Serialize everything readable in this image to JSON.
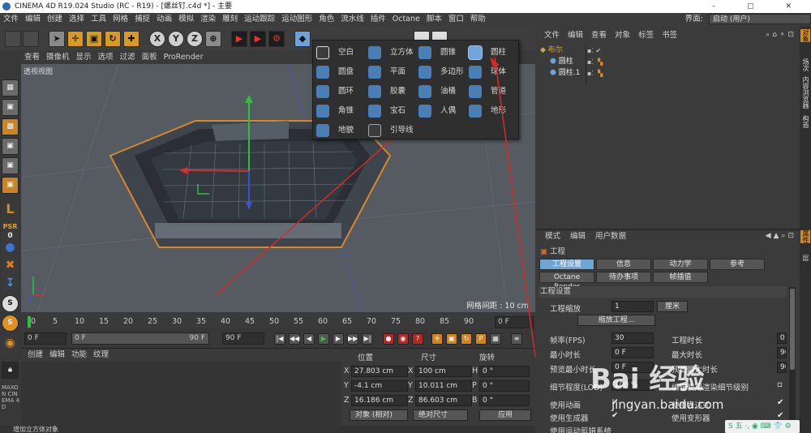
{
  "window": {
    "title": "CINEMA 4D R19.024 Studio (RC - R19) - [螺丝钉.c4d *] - 主要",
    "controls": "– ▢ ✕"
  },
  "menubar": {
    "items": [
      "文件",
      "编辑",
      "创建",
      "选择",
      "工具",
      "网格",
      "捕捉",
      "动画",
      "模拟",
      "渲染",
      "雕刻",
      "运动跟踪",
      "运动图形",
      "角色",
      "流水线",
      "插件",
      "Octane",
      "脚本",
      "窗口",
      "帮助"
    ],
    "layout_label": "界面:",
    "layout_value": "启动 (用户)"
  },
  "toolbar": {
    "x_axis": "X",
    "y_axis": "Y",
    "z_axis": "Z"
  },
  "left_tools": {
    "psr_label": "PSR",
    "psr_value": "0",
    "s_label": "S",
    "maxon_label": "MAXON CINEMA 4D"
  },
  "viewport": {
    "menu": [
      "查看",
      "摄像机",
      "显示",
      "选项",
      "过滤",
      "面板",
      "ProRender"
    ],
    "view_name": "透视视图",
    "grid_spacing": "网格间距 : 10 cm"
  },
  "popup": {
    "items": [
      {
        "icon": "null-icon",
        "label": "空白"
      },
      {
        "icon": "cube-icon",
        "label": "立方体"
      },
      {
        "icon": "cone-icon",
        "label": "圆锥"
      },
      {
        "icon": "cylinder-icon",
        "label": "圆柱"
      },
      {
        "icon": "disc-icon",
        "label": "圆盘"
      },
      {
        "icon": "plane-icon",
        "label": "平面"
      },
      {
        "icon": "polygon-icon",
        "label": "多边形"
      },
      {
        "icon": "sphere-icon",
        "label": "球体"
      },
      {
        "icon": "torus-icon",
        "label": "圆环"
      },
      {
        "icon": "capsule-icon",
        "label": "胶囊"
      },
      {
        "icon": "oiltank-icon",
        "label": "油桶"
      },
      {
        "icon": "tube-icon",
        "label": "管道"
      },
      {
        "icon": "pyramid-icon",
        "label": "角锥"
      },
      {
        "icon": "platonic-icon",
        "label": "宝石"
      },
      {
        "icon": "figure-icon",
        "label": "人偶"
      },
      {
        "icon": "landscape-icon",
        "label": "地形"
      },
      {
        "icon": "relief-icon",
        "label": "地貌"
      },
      {
        "icon": "guide-icon",
        "label": "引导线"
      }
    ]
  },
  "timeline": {
    "ticks": [
      "0",
      "5",
      "10",
      "15",
      "20",
      "25",
      "30",
      "35",
      "40",
      "45",
      "50",
      "55",
      "60",
      "65",
      "70",
      "75",
      "80",
      "85",
      "90"
    ],
    "frame_box": "0 F"
  },
  "playback": {
    "start": "0 F",
    "slider_start": "0 F",
    "slider_end": "90 F",
    "end": "90 F"
  },
  "material": {
    "menu": [
      "创建",
      "编辑",
      "功能",
      "纹理"
    ]
  },
  "coordinates": {
    "headers": {
      "position": "位置",
      "size": "尺寸",
      "rotation": "旋转"
    },
    "rows": [
      {
        "axis": "X",
        "pos": "27.803 cm",
        "size_axis": "X",
        "size": "100 cm",
        "rot_axis": "H",
        "rot": "0 °"
      },
      {
        "axis": "Y",
        "pos": "-4.1 cm",
        "size_axis": "Y",
        "size": "10.011 cm",
        "rot_axis": "P",
        "rot": "0 °"
      },
      {
        "axis": "Z",
        "pos": "16.186 cm",
        "size_axis": "Z",
        "size": "86.603 cm",
        "rot_axis": "B",
        "rot": "0 °"
      }
    ],
    "mode": "对象 (相对)",
    "size_mode": "绝对尺寸",
    "apply": "应用"
  },
  "status": {
    "text": "增加立方体对象"
  },
  "object_manager": {
    "menu": [
      "文件",
      "编辑",
      "查看",
      "对象",
      "标签",
      "书签"
    ],
    "objects": [
      {
        "name": "布尔",
        "indent": 0,
        "color": "#e0a23a"
      },
      {
        "name": "圆柱",
        "indent": 1,
        "color": "#e8e8e8"
      },
      {
        "name": "圆柱.1",
        "indent": 1,
        "color": "#e8e8e8"
      }
    ]
  },
  "attr_manager": {
    "menu": [
      "模式",
      "编辑",
      "用户数据"
    ],
    "section": "工程",
    "tabs_row1": [
      "工程设置",
      "信息",
      "动力学",
      "参考"
    ],
    "tabs_row2": [
      "Octane Render",
      "待办事项",
      "帧插值"
    ],
    "group_title": "工程设置",
    "scale_label": "工程缩放",
    "scale_value": "1",
    "scale_unit": "厘米",
    "scale_button": "缩放工程...",
    "fps_label": "帧率(FPS)",
    "fps_value": "30",
    "duration_label": "工程时长",
    "duration_value": "0",
    "min_time_label": "最小时长",
    "min_time_value": "0 F",
    "max_time_label": "最大时长",
    "max_time_value": "90",
    "prev_min_label": "预览最小时长",
    "prev_min_value": "0 F",
    "prev_max_label": "预览最大时长",
    "prev_max_value": "90",
    "lod_label": "细节程度(LOD)",
    "lod_value": "100 %",
    "lod_render_label": "编辑使用渲染细节级别",
    "use_anim_label": "使用动画",
    "use_expr_label": "使用表达式",
    "use_gen_label": "使用生成器",
    "use_deform_label": "使用变形器",
    "use_motion_label": "使用运动剪辑系统"
  },
  "right_strip": [
    "对象",
    "场次",
    "内容浏览器",
    "构造",
    "属性",
    "层"
  ],
  "watermark": {
    "brand": "Bai 经验",
    "url": "jingyan.baidu.com"
  },
  "ime": {
    "text": "S 五 ·, ◉ ⌨ 👕 ⚙"
  }
}
